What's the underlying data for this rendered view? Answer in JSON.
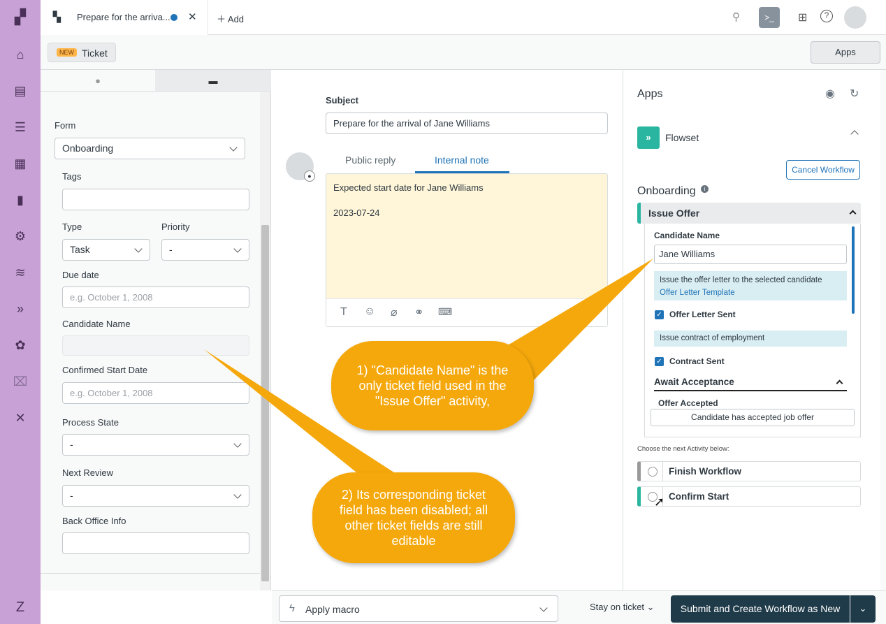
{
  "tab": {
    "title": "Prepare for the arriva...",
    "add_label": "Add"
  },
  "subbar": {
    "badge": "NEW",
    "ticket_label": "Ticket",
    "apps_button": "Apps"
  },
  "left": {
    "form_label": "Form",
    "form_value": "Onboarding",
    "tags_label": "Tags",
    "tags_value": "",
    "type_label": "Type",
    "type_value": "Task",
    "priority_label": "Priority",
    "priority_value": "-",
    "due_label": "Due date",
    "due_placeholder": "e.g. October 1, 2008",
    "candidate_label": "Candidate Name",
    "candidate_value": "",
    "start_label": "Confirmed Start Date",
    "start_placeholder": "e.g. October 1, 2008",
    "process_label": "Process State",
    "process_value": "-",
    "review_label": "Next Review",
    "review_value": "-",
    "backoffice_label": "Back Office Info",
    "backoffice_value": ""
  },
  "middle": {
    "subject_label": "Subject",
    "subject_value": "Prepare for the arrival of Jane Williams",
    "tab_public": "Public reply",
    "tab_internal": "Internal note",
    "note_line1": "Expected start date for Jane Williams",
    "note_line2": "2023-07-24"
  },
  "apps": {
    "title": "Apps",
    "app_name": "Flowset",
    "cancel_button": "Cancel Workflow",
    "workflow_title": "Onboarding",
    "activity": "Issue Offer",
    "candidate_label": "Candidate Name",
    "candidate_value": "Jane Williams",
    "info1": "Issue the offer letter to the selected candidate",
    "info1_link": "Offer Letter Template",
    "check1": "Offer Letter Sent",
    "info2": "Issue contract of employment",
    "check2": "Contract Sent",
    "await_title": "Await Acceptance",
    "offer_accepted": "Offer Accepted",
    "accepted_button": "Candidate has accepted job offer",
    "next_label": "Choose the next Activity below:",
    "opt1": "Finish Workflow",
    "opt2": "Confirm Start"
  },
  "bottom": {
    "macro": "Apply macro",
    "stay": "Stay on ticket",
    "submit": "Submit and Create Workflow as New"
  },
  "callouts": {
    "c1": "1) \"Candidate Name\" is the only ticket field used in the \"Issue Offer\" activity,",
    "c2": "2) Its corresponding ticket field has been disabled; all other ticket fields are still editable"
  },
  "colors": {
    "nav": "#c8a2d6",
    "callout": "#f5a80c",
    "accent": "#1f73b7",
    "teal": "#2ab5a0",
    "submit": "#1f3a48",
    "note": "#fff6d9"
  }
}
